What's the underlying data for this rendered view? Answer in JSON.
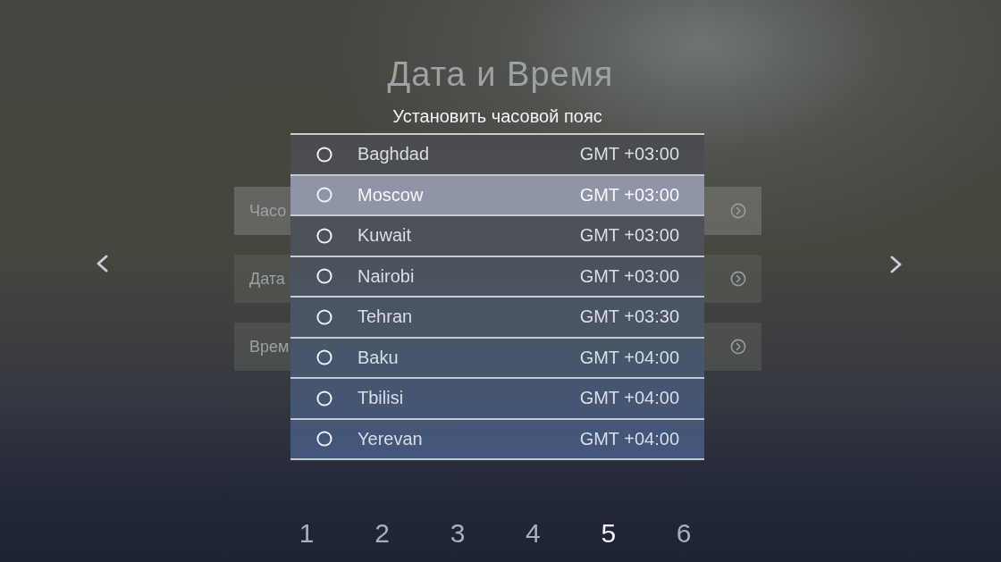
{
  "page": {
    "title": "Дата и Время"
  },
  "settings_list": [
    {
      "label": "Часо",
      "selected": true
    },
    {
      "label": "Дата",
      "selected": false
    },
    {
      "label": "Врем",
      "selected": false
    }
  ],
  "dialog": {
    "title": "Установить часовой пояс",
    "items": [
      {
        "name": "Baghdad",
        "offset": "GMT +03:00",
        "selected": false,
        "checked": false
      },
      {
        "name": "Moscow",
        "offset": "GMT +03:00",
        "selected": true,
        "checked": false
      },
      {
        "name": "Kuwait",
        "offset": "GMT +03:00",
        "selected": false,
        "checked": false
      },
      {
        "name": "Nairobi",
        "offset": "GMT +03:00",
        "selected": false,
        "checked": false
      },
      {
        "name": "Tehran",
        "offset": "GMT +03:30",
        "selected": false,
        "checked": false
      },
      {
        "name": "Baku",
        "offset": "GMT +04:00",
        "selected": false,
        "checked": false
      },
      {
        "name": "Tbilisi",
        "offset": "GMT +04:00",
        "selected": false,
        "checked": false
      },
      {
        "name": "Yerevan",
        "offset": "GMT +04:00",
        "selected": false,
        "checked": false
      }
    ]
  },
  "pager": [
    {
      "label": "1",
      "selected": false
    },
    {
      "label": "2",
      "selected": false
    },
    {
      "label": "3",
      "selected": false
    },
    {
      "label": "4",
      "selected": false
    },
    {
      "label": "5",
      "selected": true
    },
    {
      "label": "6",
      "selected": false
    }
  ]
}
